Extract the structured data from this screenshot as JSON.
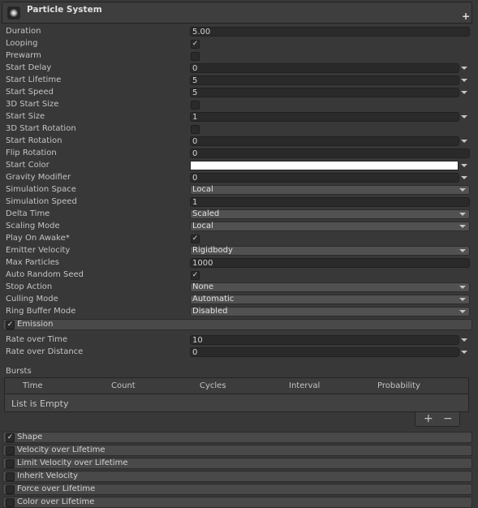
{
  "header": {
    "title": "Particle System"
  },
  "properties": [
    {
      "label": "Duration",
      "kind": "text",
      "value": "5.00"
    },
    {
      "label": "Looping",
      "kind": "check",
      "checked": true
    },
    {
      "label": "Prewarm",
      "kind": "check",
      "checked": false
    },
    {
      "label": "Start Delay",
      "kind": "curve",
      "value": "0"
    },
    {
      "label": "Start Lifetime",
      "kind": "curve",
      "value": "5"
    },
    {
      "label": "Start Speed",
      "kind": "curve",
      "value": "5"
    },
    {
      "label": "3D Start Size",
      "kind": "check",
      "checked": false
    },
    {
      "label": "Start Size",
      "kind": "curve",
      "value": "1"
    },
    {
      "label": "3D Start Rotation",
      "kind": "check",
      "checked": false
    },
    {
      "label": "Start Rotation",
      "kind": "curve",
      "value": "0"
    },
    {
      "label": "Flip Rotation",
      "kind": "text",
      "value": "0"
    },
    {
      "label": "Start Color",
      "kind": "color",
      "color": "#ffffff"
    },
    {
      "label": "Gravity Modifier",
      "kind": "curve",
      "value": "0"
    },
    {
      "label": "Simulation Space",
      "kind": "dropdown",
      "value": "Local"
    },
    {
      "label": "Simulation Speed",
      "kind": "text",
      "value": "1"
    },
    {
      "label": "Delta Time",
      "kind": "dropdown",
      "value": "Scaled"
    },
    {
      "label": "Scaling Mode",
      "kind": "dropdown",
      "value": "Local"
    },
    {
      "label": "Play On Awake*",
      "kind": "check",
      "checked": true
    },
    {
      "label": "Emitter Velocity",
      "kind": "dropdown",
      "value": "Rigidbody"
    },
    {
      "label": "Max Particles",
      "kind": "text",
      "value": "1000"
    },
    {
      "label": "Auto Random Seed",
      "kind": "check",
      "checked": true
    },
    {
      "label": "Stop Action",
      "kind": "dropdown",
      "value": "None"
    },
    {
      "label": "Culling Mode",
      "kind": "dropdown",
      "value": "Automatic"
    },
    {
      "label": "Ring Buffer Mode",
      "kind": "dropdown",
      "value": "Disabled"
    }
  ],
  "emission": {
    "label": "Emission",
    "enabled": true,
    "rate_over_time": {
      "label": "Rate over Time",
      "value": "10"
    },
    "rate_over_distance": {
      "label": "Rate over Distance",
      "value": "0"
    },
    "bursts": {
      "label": "Bursts",
      "columns": [
        "Time",
        "Count",
        "Cycles",
        "Interval",
        "Probability"
      ],
      "empty_text": "List is Empty",
      "add_symbol": "+",
      "remove_symbol": "−"
    }
  },
  "modules": [
    {
      "label": "Shape",
      "enabled": true
    },
    {
      "label": "Velocity over Lifetime",
      "enabled": false
    },
    {
      "label": "Limit Velocity over Lifetime",
      "enabled": false
    },
    {
      "label": "Inherit Velocity",
      "enabled": false
    },
    {
      "label": "Force over Lifetime",
      "enabled": false
    },
    {
      "label": "Color over Lifetime",
      "enabled": false
    }
  ],
  "check_mark": "✓"
}
